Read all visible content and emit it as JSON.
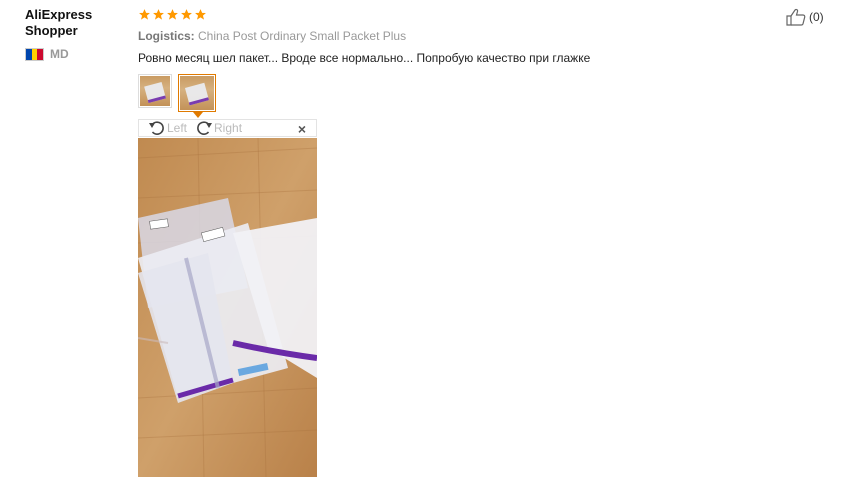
{
  "user": {
    "name": "AliExpress Shopper",
    "country_code": "MD",
    "flag_colors": [
      "#0046ae",
      "#ffd200",
      "#cc092f"
    ]
  },
  "review": {
    "rating": 5,
    "rating_max": 5,
    "logistics_label": "Logistics:",
    "logistics_value": "China Post Ordinary Small Packet Plus",
    "text": "Ровно месяц шел пакет... Вроде все нормально... Попробую качество при глажке",
    "star_color": "#ff9900"
  },
  "helpful": {
    "icon": "thumbs-up-icon",
    "count": "(0)"
  },
  "gallery": {
    "thumbnails": [
      "photo-1",
      "photo-2"
    ],
    "active_index": 1,
    "rotate_left_label": "Left",
    "rotate_right_label": "Right",
    "close_symbol": "×"
  }
}
